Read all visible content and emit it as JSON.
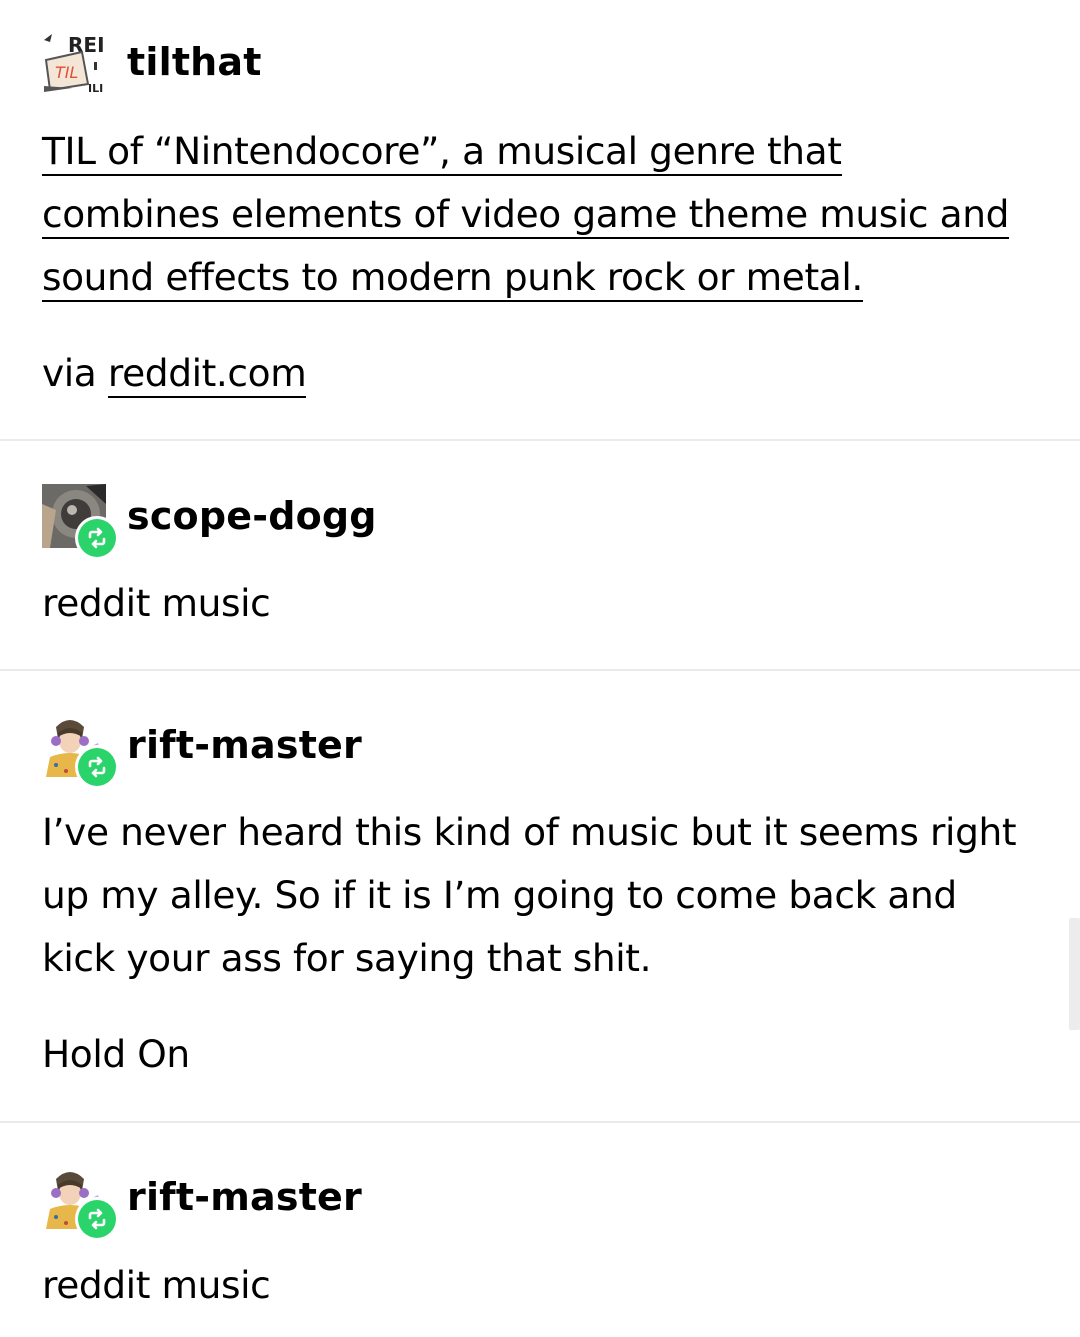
{
  "posts": [
    {
      "username": "tilthat",
      "avatar_icon": "til-logo-icon",
      "link_lines": [
        "TIL of “Nintendocore”, a musical genre that",
        "combines elements of video game theme music and",
        "sound effects to modern punk rock or metal."
      ],
      "via_prefix": "via ",
      "via_link": "reddit.com"
    },
    {
      "username": "scope-dogg",
      "avatar_icon": "photo-avatar-icon",
      "reblog_icon": "reblog-icon",
      "text": "reddit music"
    },
    {
      "username": "rift-master",
      "avatar_icon": "character-avatar-icon",
      "reblog_icon": "reblog-icon",
      "lines": [
        "I’ve never heard this kind of music but it seems right",
        "up my alley. So if it is I’m going to come back and",
        "kick your ass for saying that shit."
      ],
      "extra": "Hold On"
    },
    {
      "username": "rift-master",
      "avatar_icon": "character-avatar-icon",
      "reblog_icon": "reblog-icon",
      "text": "reddit music"
    }
  ],
  "colors": {
    "reblog_green": "#2bd46b",
    "divider": "#ebebeb",
    "text": "#000000"
  }
}
